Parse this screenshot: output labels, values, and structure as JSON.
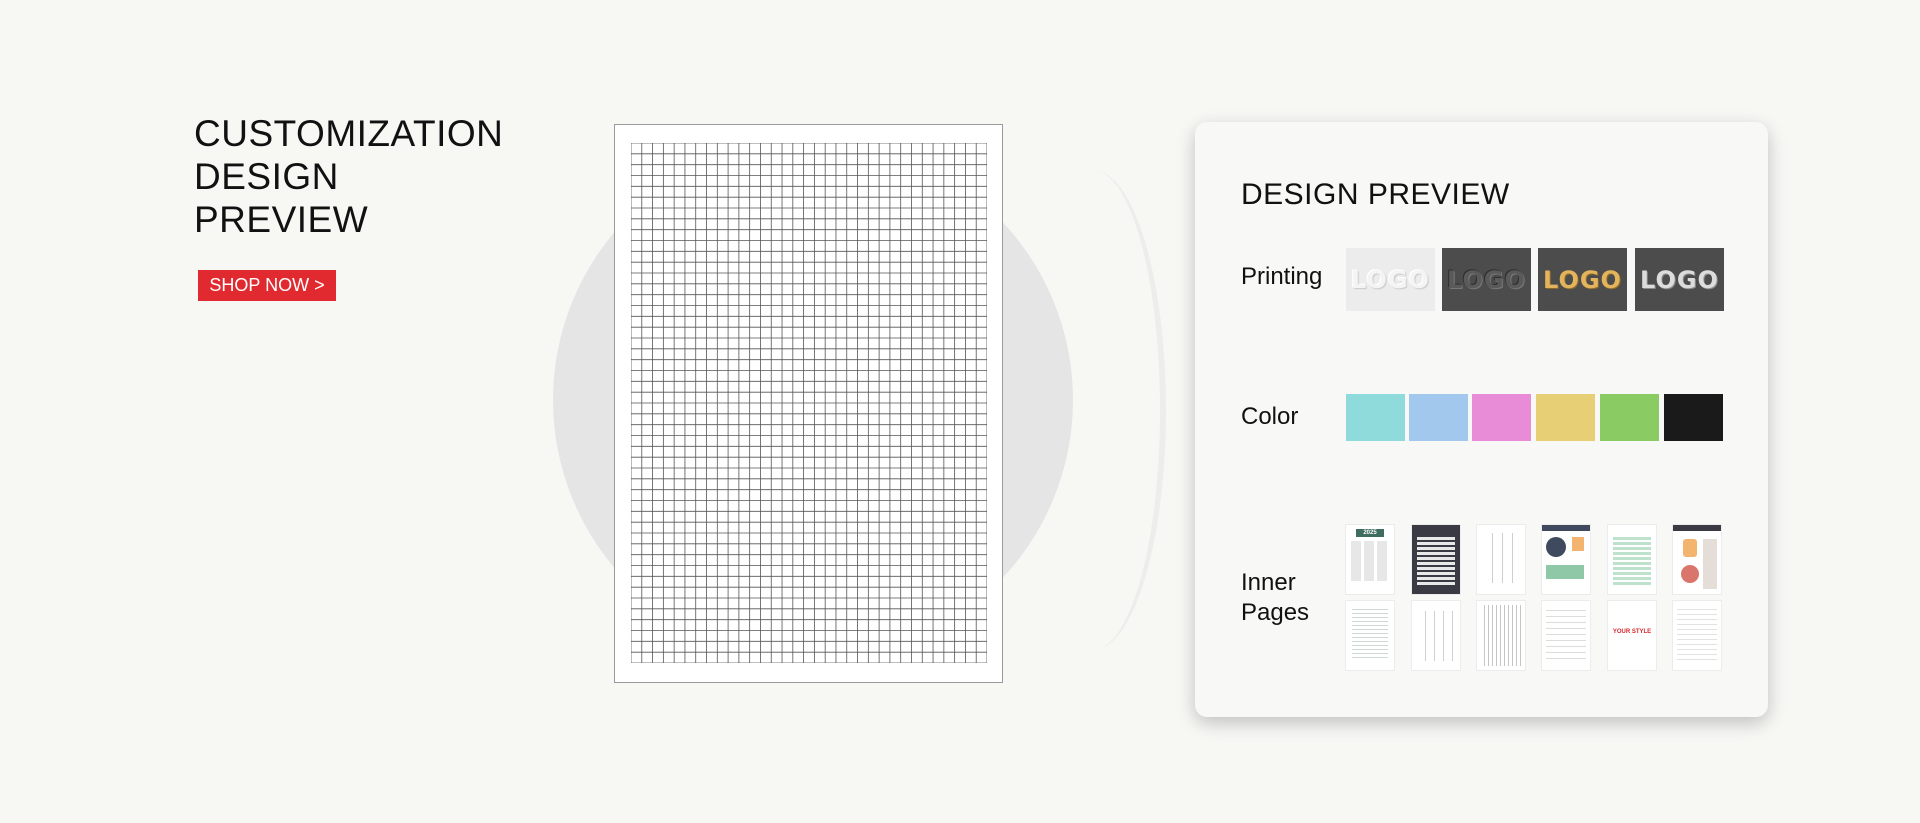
{
  "hero": {
    "title_lines": [
      "CUSTOMIZATION",
      "DESIGN",
      "PREVIEW"
    ],
    "shop_button": "SHOP NOW >"
  },
  "card": {
    "title": "DESIGN PREVIEW",
    "printing_label": "Printing",
    "color_label": "Color",
    "inner_pages_label_lines": [
      "Inner",
      "Pages"
    ],
    "logo_text": "LOGO",
    "printing_styles": [
      "white-embossed",
      "silver-debossed",
      "gold-foil",
      "silver-foil"
    ],
    "colors": [
      "#8fdbdc",
      "#a2c8ee",
      "#e98cd8",
      "#e6cf74",
      "#8acb64",
      "#1a1a1a"
    ],
    "inner_pages": {
      "year_label": "2025",
      "your_style_label": "YOUR STYLE",
      "accent": "#d9262b"
    }
  }
}
